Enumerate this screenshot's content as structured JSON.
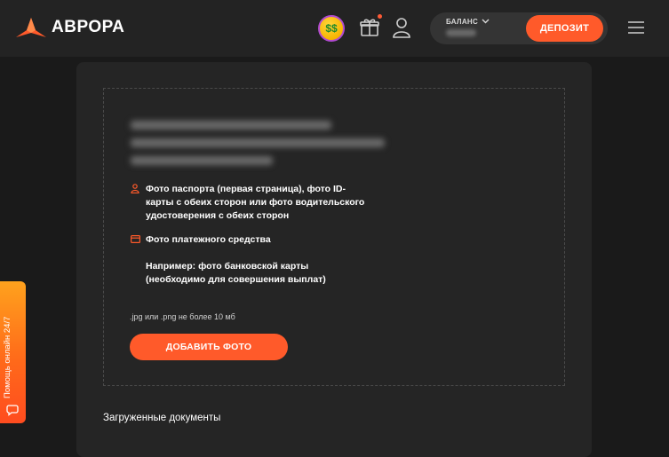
{
  "header": {
    "brand_name": "АВРОРА",
    "brand_color": "#ff5a2a",
    "emoji_icon": "money-mouth-face-icon",
    "balance_label": "БАЛАНС",
    "deposit_label": "ДЕПОЗИТ"
  },
  "upload": {
    "requirements": [
      {
        "icon": "person-icon",
        "text": "Фото паспорта (первая страница), фото ID-\nкарты с обеих сторон или фото водительского\nудостоверения с обеих сторон"
      },
      {
        "icon": "card-icon",
        "text": "Фото платежного средства"
      }
    ],
    "example_text": "Например: фото банковской карты\n(необходимо для совершения выплат)",
    "file_hint": ".jpg или .png не более 10 мб",
    "add_photo_label": "ДОБАВИТЬ ФОТО"
  },
  "uploaded_docs_title": "Загруженные документы",
  "support": {
    "label": "Помощь онлайн 24/7"
  }
}
